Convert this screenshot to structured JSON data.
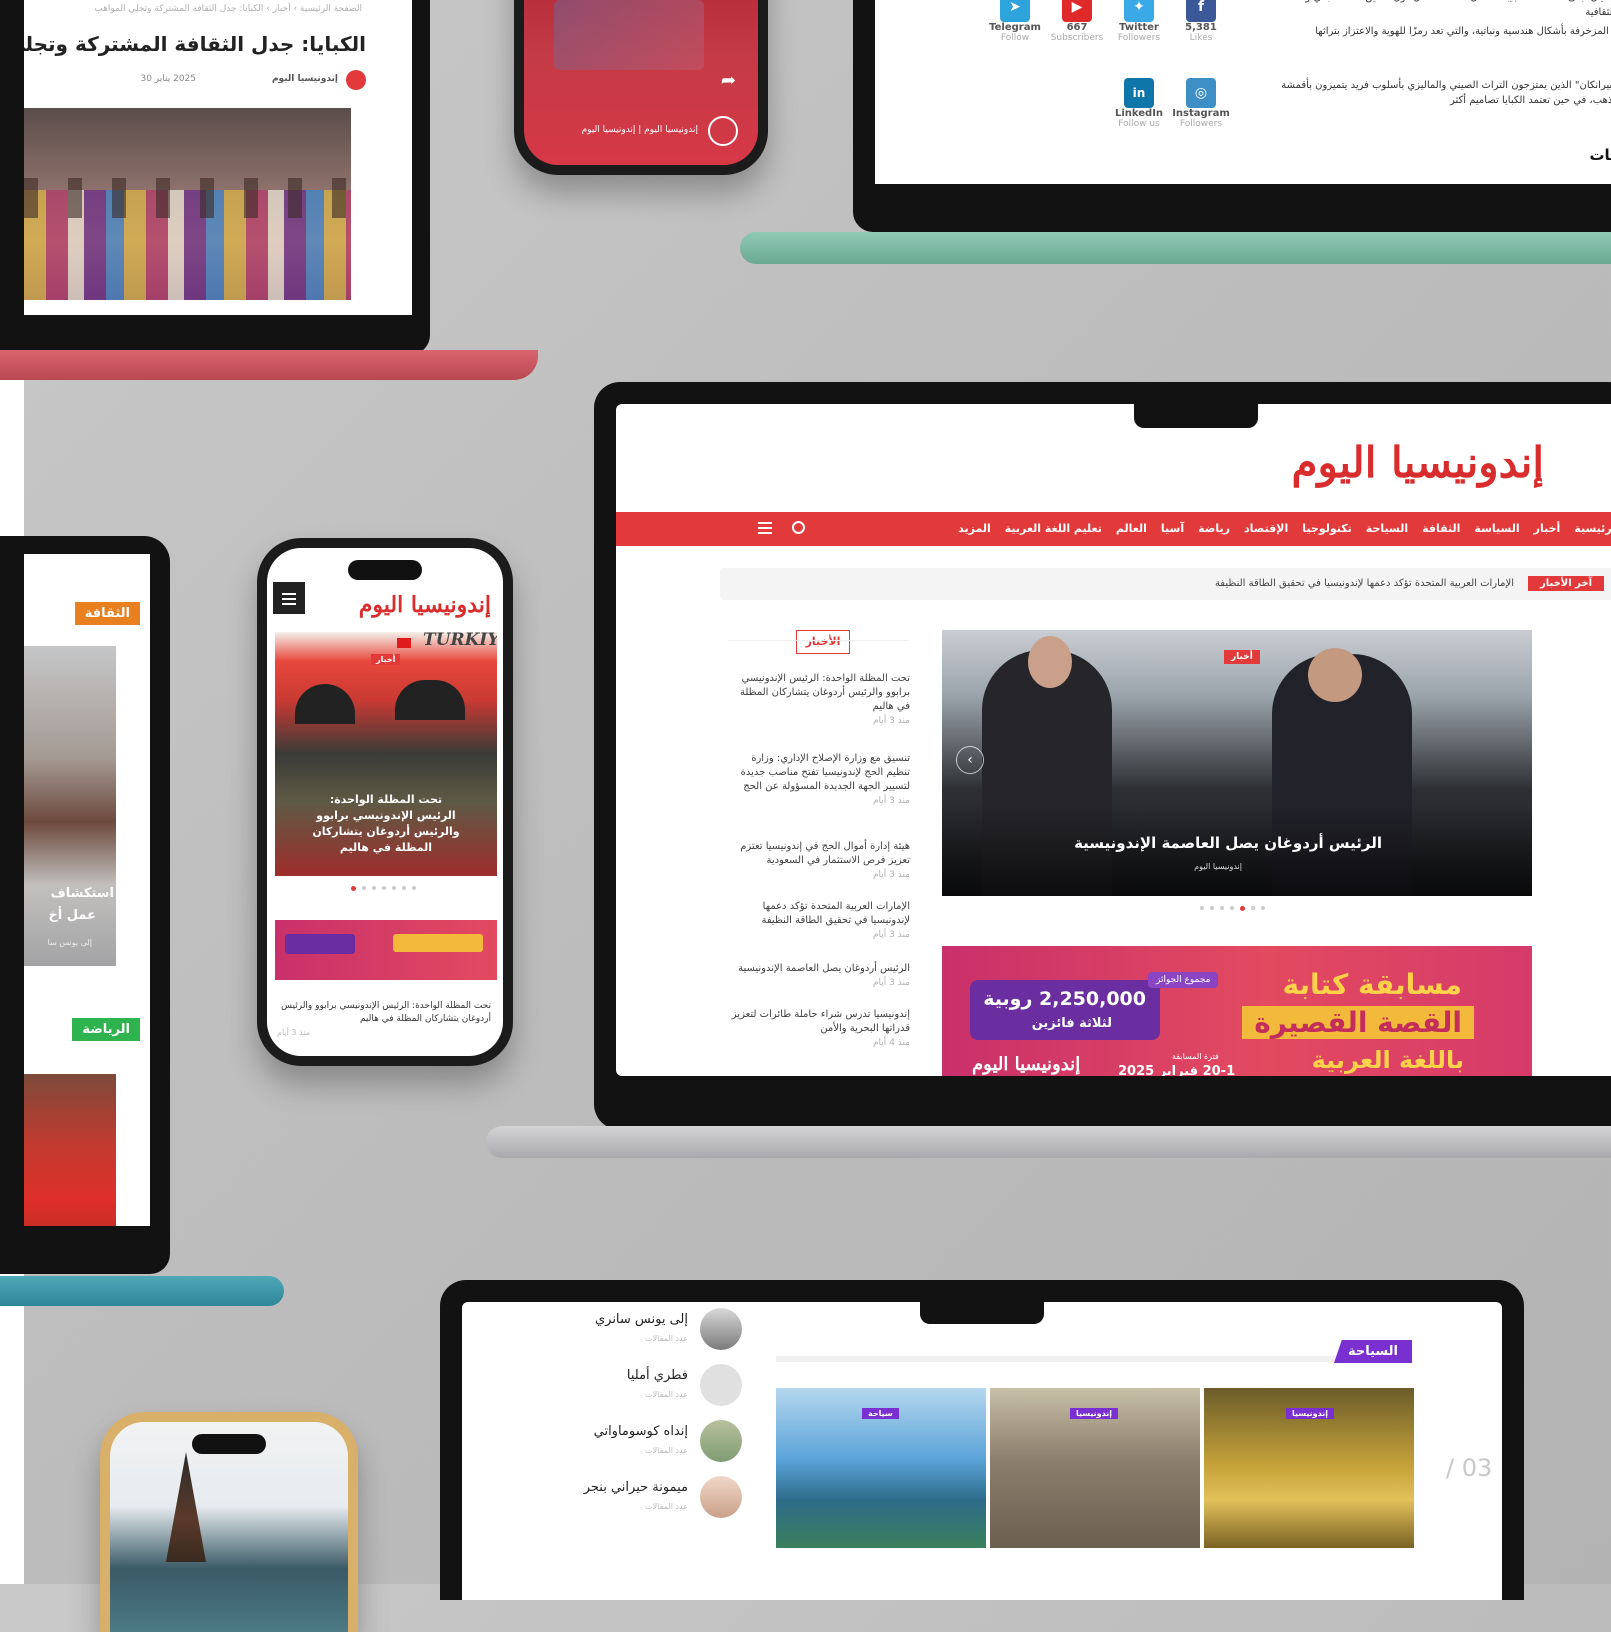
{
  "site": {
    "logo": "إندونيسيا اليوم",
    "brand_color": "#e23a3a"
  },
  "top_left": {
    "breadcrumb": "الصفحة الرئيسية › أخبار › الكبايا: جدل الثقافة المشتركة وتجلي المواهب",
    "headline": "الكبايا: جدل الثقافة المشتركة وتجلي ال",
    "author": "إندونيسيا اليوم",
    "date": "2025 يناير 30"
  },
  "top_right": {
    "socials": [
      {
        "name": "Telegram",
        "count": "Follow",
        "icon": "telegram-icon",
        "color": "#2ea4dc"
      },
      {
        "name": "667",
        "count": "Subscribers",
        "icon": "youtube-icon",
        "color": "#e02929"
      },
      {
        "name": "Twitter",
        "count": "Followers",
        "icon": "twitter-icon",
        "color": "#39a9e8"
      },
      {
        "name": "5,381",
        "count": "Likes",
        "icon": "facebook-icon",
        "color": "#3b5998"
      },
      {
        "name": "LinkedIn",
        "count": "Follow us",
        "icon": "linkedin-icon",
        "color": "#0e76a8"
      },
      {
        "name": "Instagram",
        "count": "Followers",
        "icon": "instagram-icon",
        "color": "#3f8fc7"
      }
    ],
    "para1": "البشرية الاحيان تبقى اتحادات العجيبة الشكل المختلفة مثل دول الصين ذات المباني والأعمدة التاريخية الثقافية",
    "para2": "الانتزاعات المزخرفة بأشكال هندسية ونباتية، والتي تعد رمزًا للهوية والاعتزاز بتراثها",
    "para3": "كما أن \"البيرانكان\" الذين يمتزجون التراث الصيني والماليزي بأسلوب فريد يتميزون بأقمشة الحرير والذهب، في حين تعتمد الكبايا تصاميم أكثر",
    "heading": "الخلافات"
  },
  "main": {
    "nav": [
      "الرئيسية",
      "أخبار",
      "السياسة",
      "الثقافة",
      "السياحة",
      "تكنولوجيا",
      "الإقتصاد",
      "رياضة",
      "آسيا",
      "العالم",
      "تعليم اللغة العربية",
      "المزيد"
    ],
    "ticker_label": "آخر الأخبار",
    "ticker_text": "الإمارات العربية المتحدة تؤكد دعمها لإندونيسيا في تحقيق الطاقة النظيفة",
    "side_tab": "الأخبار",
    "side_items": [
      {
        "title": "تحت المظلة الواحدة: الرئيس الإندونيسي برابوو والرئيس أردوغان يتشاركان المظلة في هاليم",
        "date": "منذ 3 أيام"
      },
      {
        "title": "تنسيق مع وزارة الإصلاح الإداري: وزارة تنظيم الحج لإندونيسيا تفتح مناصب جديدة لتسيير الجهة الجديدة المسؤولة عن الحج",
        "date": "منذ 3 أيام"
      },
      {
        "title": "هيئة إدارة أموال الحج في إندونيسيا تعتزم تعزيز فرص الاستثمار في السعودية",
        "date": "منذ 3 أيام"
      },
      {
        "title": "الإمارات العربية المتحدة تؤكد دعمها لإندونيسيا في تحقيق الطاقة النظيفة",
        "date": "منذ 3 أيام"
      },
      {
        "title": "الرئيس أردوغان يصل العاصمة الإندونيسية",
        "date": "منذ 3 أيام"
      },
      {
        "title": "إندونيسيا تدرس شراء حاملة طائرات لتعزيز قدراتها البحرية والأمن",
        "date": "منذ 4 أيام"
      }
    ],
    "hero_badge": "أخبار",
    "hero_caption": "الرئيس أردوغان يصل العاصمة الإندونيسية",
    "hero_meta": "إندونيسيا اليوم",
    "banner_title1": "مسابقة كتابة",
    "banner_title2": "القصة القصيرة",
    "banner_title3": "باللغة العربية",
    "banner_prize_tag": "مجموع الجوائز",
    "banner_prize": "2,250,000 روبية",
    "banner_prize_sub": "لثلاثة فائزين",
    "banner_dates_label": "فترة المسابقة",
    "banner_dates": "20-1 فبراير 2025"
  },
  "left_laptop": {
    "culture_badge": "الثقافة",
    "sports_badge": "الرياضة",
    "culture_text_1": "استكشاف",
    "culture_text_2": "عمل أخ",
    "culture_meta": "إلى يونس سا"
  },
  "center_phone": {
    "hero_badge": "أخبار",
    "plane_text": "TÜRKIY",
    "hero_caption": "تحت المظلة الواحدة: الرئيس الإندونيسي برابوو والرئيس أردوغان يتشاركان المظلة في هاليم",
    "story_text": "تحت المظلة الواحدة: الرئيس الإندونيسي برابوو والرئيس أردوغان يتشاركان المظلة في هاليم",
    "story_date": "منذ 3 أيام"
  },
  "top_phone": {
    "caption": "إندونيسيا اليوم | إندونيسيا اليوم"
  },
  "bottom": {
    "authors": [
      {
        "name": "إلى يونس سانري",
        "meta": "عدد المقالات"
      },
      {
        "name": "فطري أمليا",
        "meta": "عدد المقالات"
      },
      {
        "name": "إنداه كوسوماواتي",
        "meta": "عدد المقالات"
      },
      {
        "name": "ميمونة حيراني بنجر",
        "meta": "عدد المقالات"
      }
    ],
    "tourism_badge": "السياحة",
    "cards": [
      {
        "badge": "سياحة"
      },
      {
        "badge": "إندونيسيا"
      },
      {
        "badge": "إندونيسيا"
      }
    ],
    "page_counter": "/ 03"
  }
}
